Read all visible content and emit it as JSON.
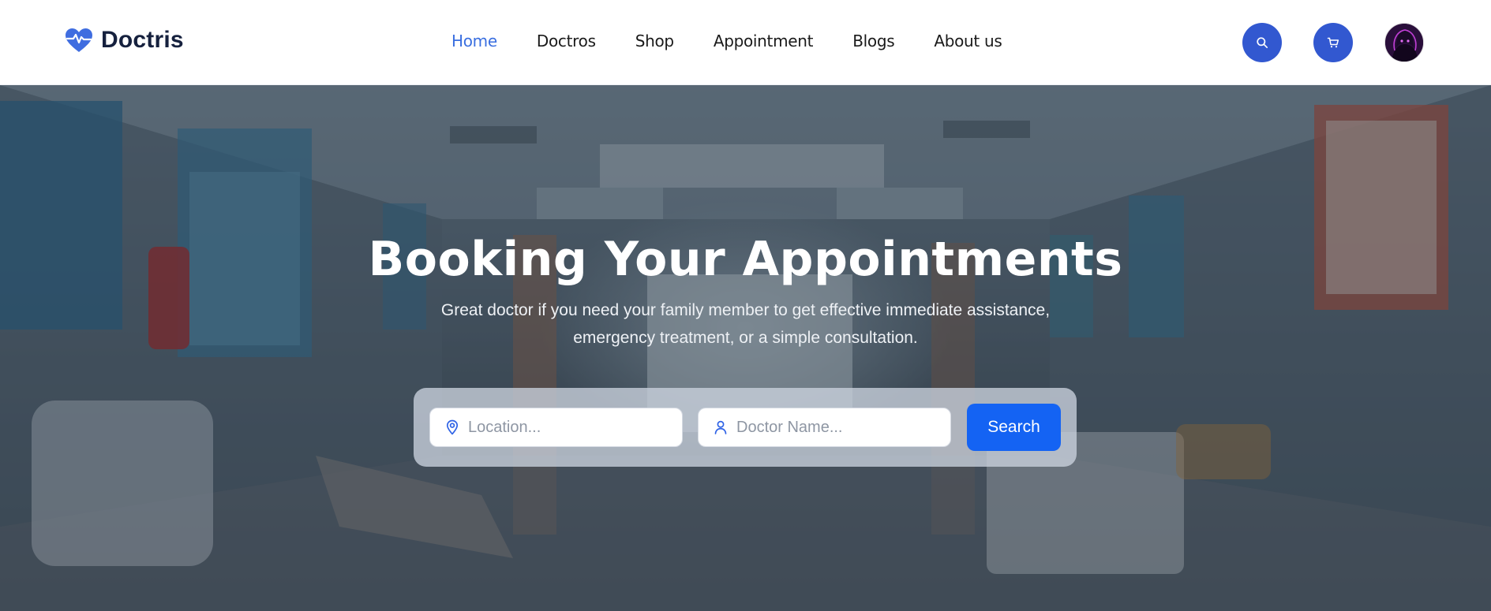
{
  "brand": {
    "name": "Doctris",
    "logo_icon": "heart-pulse-icon",
    "accent_color": "#3258d0"
  },
  "nav": {
    "items": [
      {
        "label": "Home",
        "active": true
      },
      {
        "label": "Doctros",
        "active": false
      },
      {
        "label": "Shop",
        "active": false
      },
      {
        "label": "Appointment",
        "active": false
      },
      {
        "label": "Blogs",
        "active": false
      },
      {
        "label": "About us",
        "active": false
      }
    ],
    "active_color": "#3a6fe0"
  },
  "header_actions": {
    "search_icon": "search-icon",
    "cart_icon": "cart-icon",
    "avatar": "user-avatar"
  },
  "hero": {
    "title": "Booking Your Appointments",
    "subtitle_line1": "Great doctor if you need your family member to get effective immediate assistance,",
    "subtitle_line2": "emergency treatment, or a simple consultation.",
    "search": {
      "location_placeholder": "Location...",
      "location_icon": "map-pin-icon",
      "doctor_placeholder": "Doctor Name...",
      "doctor_icon": "user-icon",
      "button_label": "Search",
      "button_color": "#1463f3"
    }
  }
}
